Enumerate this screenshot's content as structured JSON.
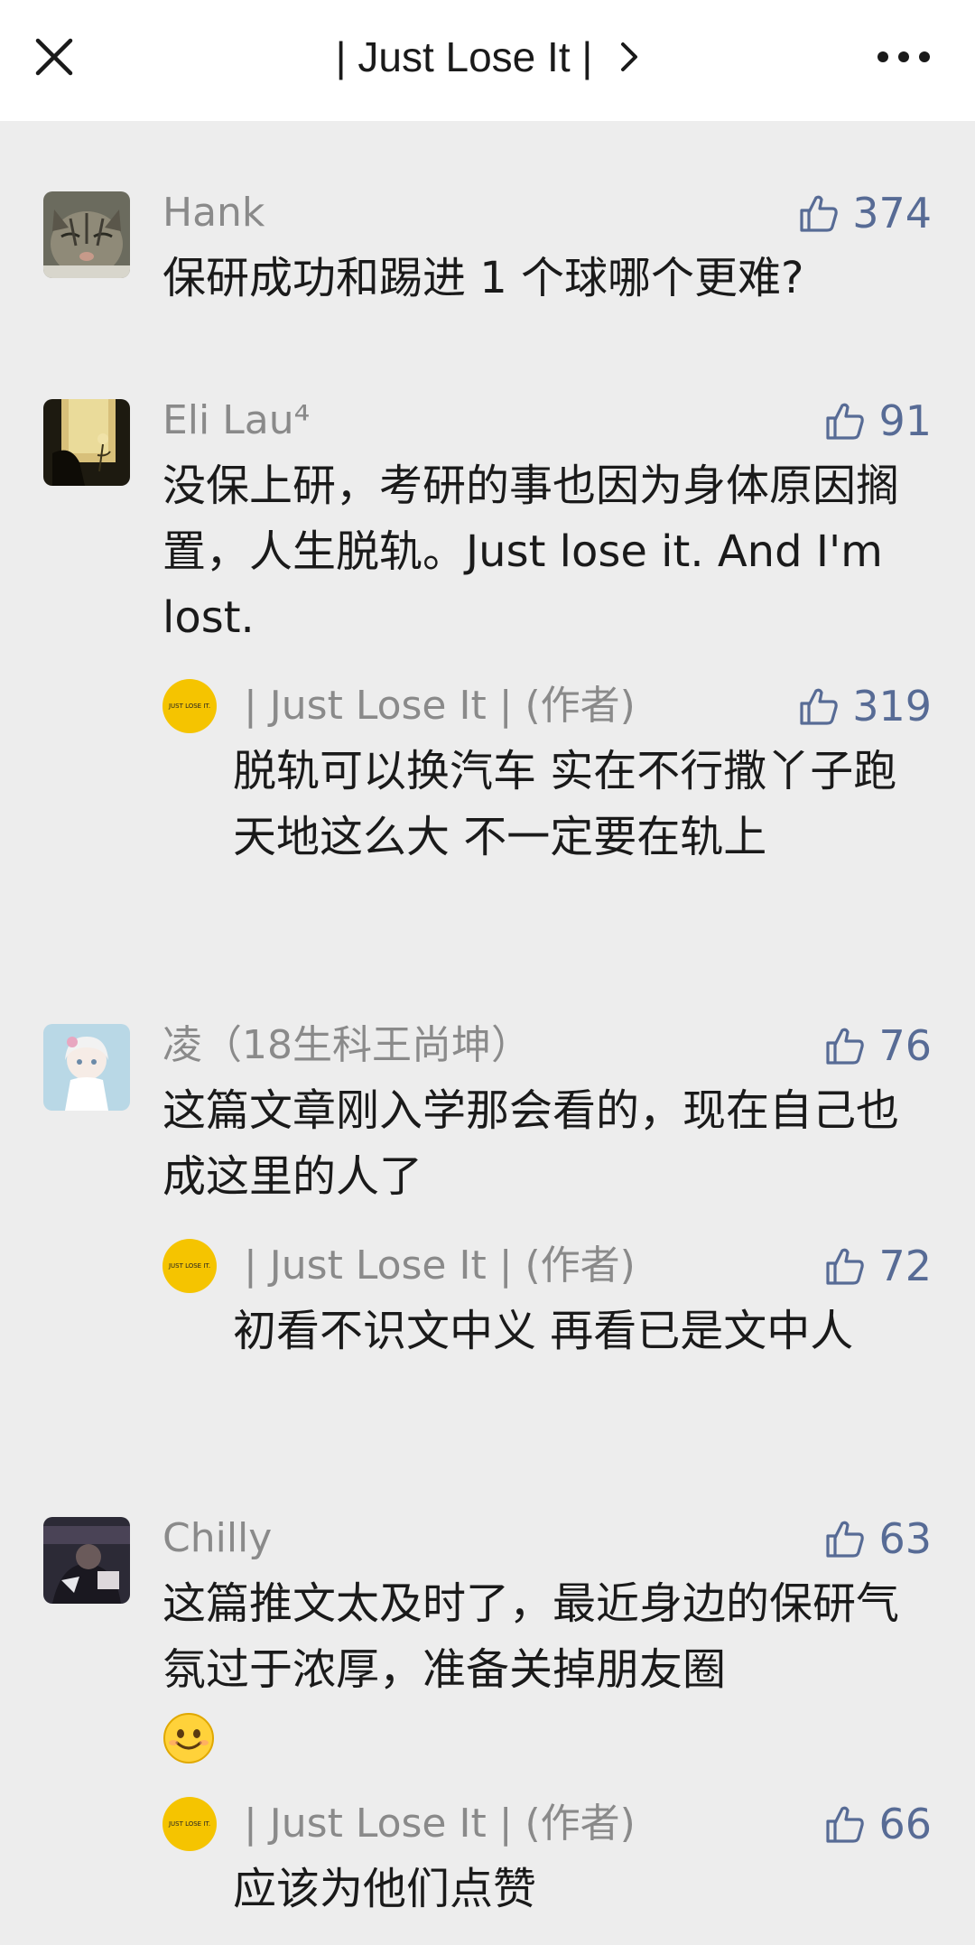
{
  "header": {
    "title": "| Just Lose It |"
  },
  "comments": [
    {
      "author": "Hank",
      "likes": "374",
      "text": "保研成功和踢进 1 个球哪个更难?"
    },
    {
      "author": "Eli Lau⁴",
      "likes": "91",
      "text": "没保上研，考研的事也因为身体原因搁置，人生脱轨。Just lose it. And I'm lost.",
      "reply": {
        "author": "| Just Lose It | (作者)",
        "likes": "319",
        "text": "脱轨可以换汽车 实在不行撒丫子跑 天地这么大 不一定要在轨上"
      }
    },
    {
      "author": "凌（18生科王尚坤）",
      "likes": "76",
      "text": "这篇文章刚入学那会看的，现在自己也成这里的人了",
      "reply": {
        "author": "| Just Lose It | (作者)",
        "likes": "72",
        "text": "初看不识文中义 再看已是文中人"
      }
    },
    {
      "author": "Chilly",
      "likes": "63",
      "text": "这篇推文太及时了，最近身边的保研气氛过于浓厚，准备关掉朋友圈",
      "emoji": "smile-emoji",
      "reply": {
        "author": "| Just Lose It | (作者)",
        "likes": "66",
        "text": "应该为他们点赞"
      }
    }
  ],
  "reply_avatar_text": "JUST LOSE IT.",
  "colors": {
    "like_blue": "#576b95",
    "author_gray": "#8a8a8a",
    "background": "#ededed",
    "reply_avatar": "#f5c400"
  }
}
